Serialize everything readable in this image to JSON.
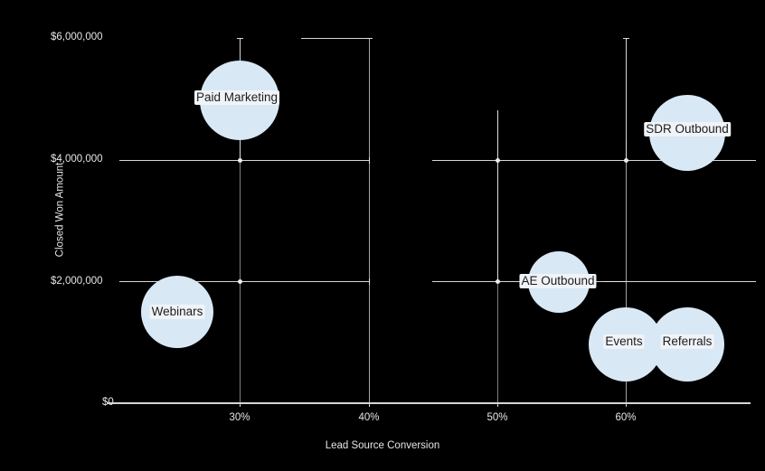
{
  "chart_data": {
    "type": "scatter",
    "title": "",
    "xlabel": "Lead Source Conversion",
    "ylabel": "Closed Won Amount",
    "xlim": [
      0.2,
      0.7
    ],
    "ylim": [
      0,
      6600000
    ],
    "x_tick_labels": [
      "30%",
      "40%",
      "50%",
      "60%"
    ],
    "x_tick_values": [
      0.3,
      0.4,
      0.5,
      0.6
    ],
    "y_tick_labels": [
      "$0",
      "$2,000,000",
      "$4,000,000",
      "$6,000,000"
    ],
    "y_tick_values": [
      0,
      2000000,
      4000000,
      6000000
    ],
    "grid": false,
    "legend": "none",
    "bubble_color": "#d9e8f5",
    "axis_color": "#d6d6d6",
    "background_color": "#000000",
    "text_color": "#e6e6e6",
    "points": [
      {
        "label": "Paid Marketing",
        "x": 0.3,
        "y": 4000000,
        "size": 44,
        "x_err_low": 0.3,
        "x_err_high": 0.4,
        "y_err_low": 4000000,
        "y_err_high": 6400000
      },
      {
        "label": "Webinars",
        "x": 0.268,
        "y": 2000000,
        "size": 40,
        "x_err_low": 0.268,
        "x_err_high": 0.3,
        "y_err_low": 1250000,
        "y_err_high": 2000000
      },
      {
        "label": "AE Outbound",
        "x": 0.553,
        "y": 2000000,
        "size": 34,
        "x_err_low": 0.5,
        "x_err_high": 0.6,
        "y_err_low": 2000000,
        "y_err_high": 4000000
      },
      {
        "label": "SDR Outbound",
        "x": 0.635,
        "y": 4000000,
        "size": 38,
        "x_err_low": 0.6,
        "x_err_high": 0.7,
        "y_err_low": 4000000,
        "y_err_high": 5100000
      },
      {
        "label": "Events",
        "x": 0.6,
        "y": 1100000,
        "size": 39,
        "x_err_low": 0.6,
        "x_err_high": 0.6,
        "y_err_low": 0,
        "y_err_high": 2000000
      },
      {
        "label": "Referrals",
        "x": 0.663,
        "y": 1100000,
        "size": 39,
        "x_err_low": 0.663,
        "x_err_high": 0.663,
        "y_err_low": 1100000,
        "y_err_high": 1100000
      }
    ]
  },
  "axes": {
    "x_title": "Lead Source Conversion",
    "y_title": "Closed Won Amount",
    "x_ticks": [
      {
        "label": "30%"
      },
      {
        "label": "40%"
      },
      {
        "label": "50%"
      },
      {
        "label": "60%"
      }
    ],
    "y_ticks": [
      {
        "label": "$6,000,000"
      },
      {
        "label": "$4,000,000"
      },
      {
        "label": "$2,000,000"
      },
      {
        "label": "$0"
      }
    ]
  },
  "bubbles": [
    {
      "label": "Paid Marketing"
    },
    {
      "label": "Webinars"
    },
    {
      "label": "AE Outbound"
    },
    {
      "label": "SDR Outbound"
    },
    {
      "label": "Events"
    },
    {
      "label": "Referrals"
    }
  ]
}
